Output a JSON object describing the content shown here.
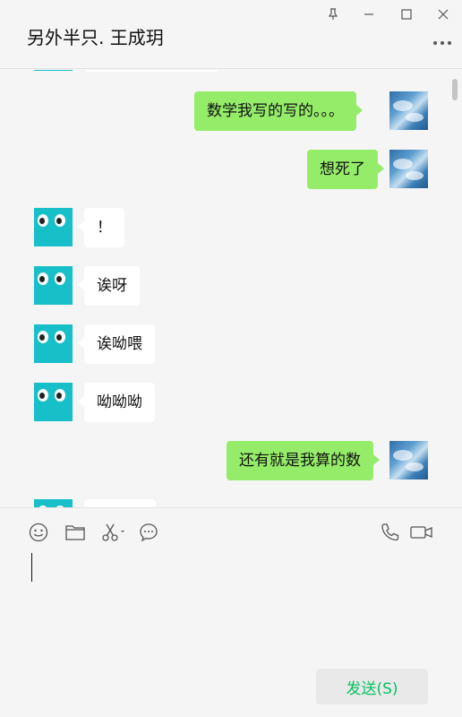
{
  "header": {
    "title": "另外半只. 王成玥"
  },
  "window_controls": [
    "pin-icon",
    "minimize-icon",
    "maximize-icon",
    "close-icon"
  ],
  "messages": [
    {
      "sender": "other",
      "text": ""
    },
    {
      "sender": "me",
      "text": "数学我写的写的。。。"
    },
    {
      "sender": "me",
      "text": "想死了"
    },
    {
      "sender": "other",
      "text": "！"
    },
    {
      "sender": "other",
      "text": "诶呀"
    },
    {
      "sender": "other",
      "text": "诶呦喂"
    },
    {
      "sender": "other",
      "text": "呦呦呦"
    },
    {
      "sender": "me",
      "text": "还有就是我算的数"
    },
    {
      "sender": "other",
      "text": ""
    }
  ],
  "toolbar": {
    "left_icons": [
      "emoji-icon",
      "folder-icon",
      "scissors-icon",
      "chat-history-icon"
    ],
    "right_icons": [
      "phone-icon",
      "video-icon"
    ]
  },
  "input": {
    "value": ""
  },
  "send_button": {
    "label": "发送(S)"
  },
  "colors": {
    "my_bubble": "#95ec69",
    "their_bubble": "#ffffff",
    "background": "#f5f5f5",
    "send_text": "#07c160"
  }
}
